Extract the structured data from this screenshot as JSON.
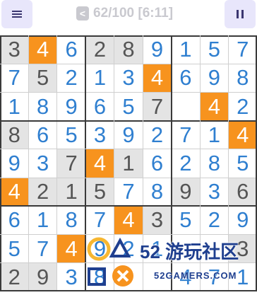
{
  "header": {
    "progress_label": "62/100 [6:11]",
    "back_glyph": "<",
    "menu_icon": "menu-icon",
    "pause_icon": "pause-icon"
  },
  "colors": {
    "highlight": "#f7931e",
    "given_text": "#555555",
    "player_text": "#2f7fd0",
    "highlight_text": "#ffffff",
    "gray_cell": "#e4e4e4"
  },
  "grid": {
    "cells": [
      [
        "3",
        "4",
        "6",
        "2",
        "8",
        "9",
        "1",
        "5",
        "7"
      ],
      [
        "7",
        "5",
        "2",
        "1",
        "3",
        "4",
        "6",
        "9",
        "8"
      ],
      [
        "1",
        "8",
        "9",
        "6",
        "5",
        "7",
        "",
        "4",
        "2"
      ],
      [
        "8",
        "6",
        "5",
        "3",
        "9",
        "2",
        "7",
        "1",
        "4"
      ],
      [
        "9",
        "3",
        "7",
        "4",
        "1",
        "6",
        "2",
        "8",
        "5"
      ],
      [
        "4",
        "2",
        "1",
        "5",
        "7",
        "8",
        "9",
        "3",
        "6"
      ],
      [
        "6",
        "1",
        "8",
        "7",
        "4",
        "3",
        "5",
        "2",
        "9"
      ],
      [
        "5",
        "7",
        "4",
        "9",
        "2",
        "1",
        "",
        "",
        "3"
      ],
      [
        "2",
        "9",
        "3",
        "8",
        "",
        "",
        "4",
        "7",
        "1"
      ]
    ],
    "types": [
      [
        "g",
        "h",
        "b",
        "g",
        "g",
        "b",
        "b",
        "b",
        "b"
      ],
      [
        "b",
        "g",
        "b",
        "b",
        "b",
        "h",
        "b",
        "b",
        "b"
      ],
      [
        "b",
        "b",
        "b",
        "b",
        "b",
        "g",
        "b",
        "h",
        "b"
      ],
      [
        "g",
        "b",
        "b",
        "b",
        "b",
        "b",
        "b",
        "b",
        "h"
      ],
      [
        "b",
        "b",
        "g",
        "h",
        "g",
        "b",
        "b",
        "b",
        "b"
      ],
      [
        "h",
        "g",
        "g",
        "g",
        "b",
        "b",
        "g",
        "b",
        "g"
      ],
      [
        "b",
        "b",
        "b",
        "b",
        "h",
        "g",
        "b",
        "b",
        "b"
      ],
      [
        "b",
        "b",
        "h",
        "b",
        "b",
        "b",
        "b",
        "b",
        "g"
      ],
      [
        "g",
        "g",
        "b",
        "b",
        "b",
        "b",
        "b",
        "b",
        "b"
      ]
    ]
  },
  "watermark": {
    "brand": "52 游玩社区",
    "site": "52GAMERS.COM"
  }
}
